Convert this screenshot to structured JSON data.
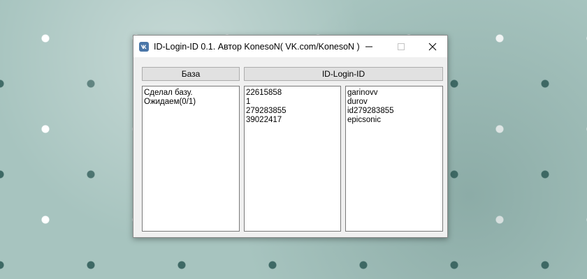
{
  "window": {
    "title": "ID-Login-ID 0.1. Автор KonesoN( VK.com/KonesoN )",
    "icon": "vk-icon"
  },
  "buttons": {
    "base_label": "База",
    "idlogin_label": "ID-Login-ID"
  },
  "log": {
    "lines": [
      "Сделал базу.",
      "Ожидаем(0/1)"
    ]
  },
  "ids": {
    "lines": [
      "22615858",
      "1",
      "279283855",
      "39022417"
    ]
  },
  "logins": {
    "lines": [
      "garinovv",
      "durov",
      "id279283855",
      "epicsonic"
    ]
  }
}
